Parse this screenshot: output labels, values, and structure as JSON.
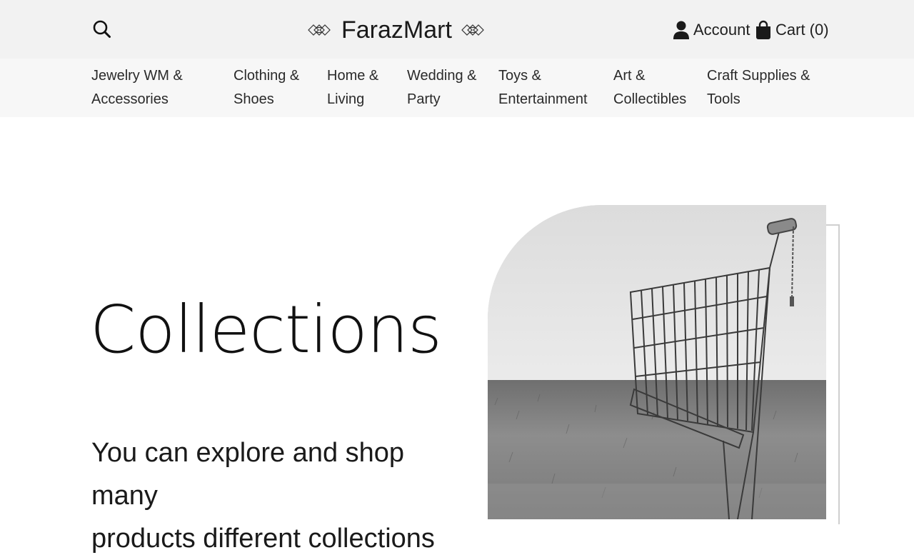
{
  "header": {
    "brand": "FarazMart",
    "account_label": "Account",
    "cart_label": "Cart (0)",
    "icons": {
      "search": "search-icon",
      "logo_mark": "diamond-lattice-icon",
      "account": "user-icon",
      "cart": "shopping-bag-icon"
    }
  },
  "nav": {
    "items": [
      {
        "line1": "Jewelry WM &",
        "line2": "Accessories"
      },
      {
        "line1": "Clothing &",
        "line2": "Shoes"
      },
      {
        "line1": "Home &",
        "line2": "Living"
      },
      {
        "line1": "Wedding &",
        "line2": "Party"
      },
      {
        "line1": "Toys &",
        "line2": "Entertainment"
      },
      {
        "line1": "Art &",
        "line2": "Collectibles"
      },
      {
        "line1": "Craft Supplies &",
        "line2": "Tools"
      }
    ]
  },
  "hero": {
    "title": "Collections",
    "subtitle_line1": "You can explore and shop many",
    "subtitle_line2": "products different collections",
    "image_icon": "shopping-cart-photo"
  },
  "colors": {
    "header_bg": "#f2f2f2",
    "nav_bg": "#f7f7f7",
    "text": "#1a1a1a",
    "frame_line": "#cfcfcf"
  }
}
